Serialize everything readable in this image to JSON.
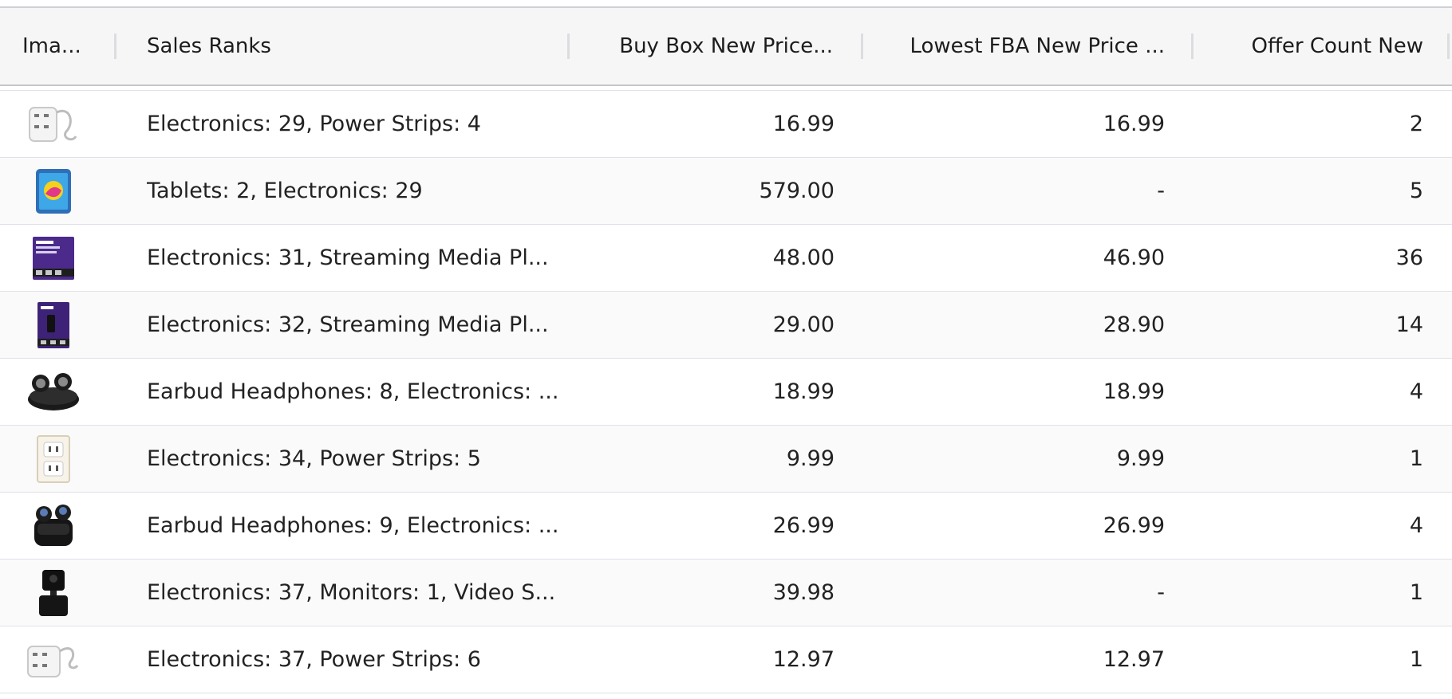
{
  "table": {
    "columns": {
      "image": "Ima...",
      "sales_ranks": "Sales Ranks",
      "buy_box_new_price": "Buy Box New Price...",
      "lowest_fba_new_price": "Lowest FBA New Price ...",
      "offer_count_new": "Offer Count New"
    },
    "rows": [
      {
        "thumb": "power-strip-thumbnail",
        "rank": "Electronics: 29, Power Strips: 4",
        "buy_box": "16.99",
        "fba": "16.99",
        "offers": "2"
      },
      {
        "thumb": "tablet-thumbnail",
        "rank": "Tablets: 2, Electronics: 29",
        "buy_box": "579.00",
        "fba": "-",
        "offers": "5"
      },
      {
        "thumb": "streaming-stick-box-thumbnail",
        "rank": "Electronics: 31, Streaming Media Pl...",
        "buy_box": "48.00",
        "fba": "46.90",
        "offers": "36"
      },
      {
        "thumb": "streaming-device-box-thumbnail",
        "rank": "Electronics: 32, Streaming Media Pl...",
        "buy_box": "29.00",
        "fba": "28.90",
        "offers": "14"
      },
      {
        "thumb": "earbuds-thumbnail",
        "rank": "Earbud Headphones: 8, Electronics: ...",
        "buy_box": "18.99",
        "fba": "18.99",
        "offers": "4"
      },
      {
        "thumb": "wall-outlet-thumbnail",
        "rank": "Electronics: 34, Power Strips: 5",
        "buy_box": "9.99",
        "fba": "9.99",
        "offers": "1"
      },
      {
        "thumb": "earbuds-case-thumbnail",
        "rank": "Earbud Headphones: 9, Electronics: ...",
        "buy_box": "26.99",
        "fba": "26.99",
        "offers": "4"
      },
      {
        "thumb": "camera-thumbnail",
        "rank": "Electronics: 37, Monitors: 1, Video S...",
        "buy_box": "39.98",
        "fba": "-",
        "offers": "1"
      },
      {
        "thumb": "power-strip-thumbnail",
        "rank": "Electronics: 37, Power Strips: 6",
        "buy_box": "12.97",
        "fba": "12.97",
        "offers": "1"
      }
    ]
  },
  "colors": {
    "header_bg": "#f6f6f6",
    "row_alt_bg": "#fafafa",
    "row_border": "#dfe1e8"
  }
}
